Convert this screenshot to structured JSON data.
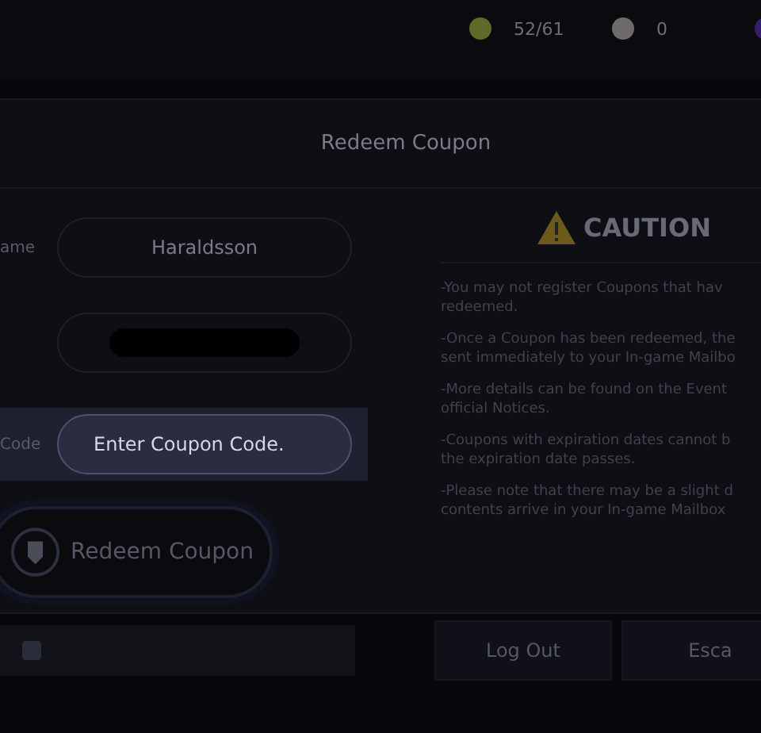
{
  "currencies": [
    {
      "color": "#5e6a2a",
      "value": "52/61"
    },
    {
      "color": "#6e6a6a",
      "value": "0"
    },
    {
      "color": "#3a1e6a"
    }
  ],
  "dialog": {
    "title": "Redeem Coupon",
    "fields": [
      {
        "label": "ame",
        "value": "Haraldsson",
        "kind": "text",
        "focused": false
      },
      {
        "kind": "redacted",
        "focused": false
      },
      {
        "label": "Code",
        "placeholder": "Enter Coupon Code.",
        "kind": "input",
        "focused": true
      }
    ],
    "redeem_button": "Redeem Coupon",
    "caution": {
      "title": "CAUTION",
      "paragraphs": [
        [
          "-You may not register Coupons that hav",
          "redeemed."
        ],
        [
          "-Once a Coupon has been redeemed, the",
          "sent immediately to your In-game Mailbo"
        ],
        [
          "-More details can be found on the Event",
          "official Notices."
        ],
        [
          "-Coupons with expiration dates cannot b",
          "the expiration date passes."
        ],
        [
          "-Please note that there may be a slight d",
          "contents arrive in your In-game Mailbox"
        ]
      ]
    }
  },
  "buttons": [
    "Log Out",
    "Esca"
  ]
}
